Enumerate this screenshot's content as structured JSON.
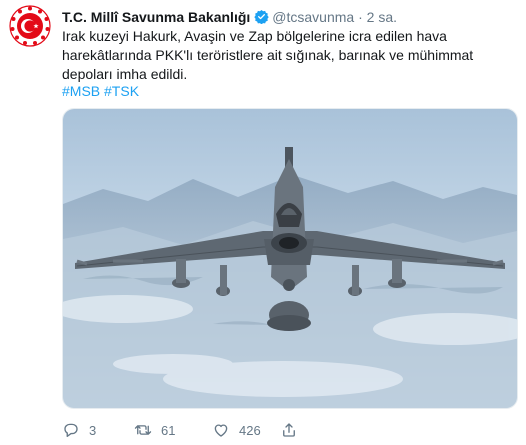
{
  "tweet": {
    "author_name": "T.C. Millî Savunma Bakanlığı",
    "handle": "@tcsavunma",
    "separator": "·",
    "time": "2 sa.",
    "text": "Irak kuzeyi Hakurk, Avaşin ve Zap bölgelerine icra edilen hava harekâtlarında PKK'lı teröristlere ait sığınak, barınak ve mühimmat depoları imha edildi.",
    "hashtags": [
      "#MSB",
      "#TSK"
    ]
  },
  "actions": {
    "replies": "3",
    "retweets": "61",
    "likes": "426"
  },
  "icons": {
    "avatar": "turkish-armed-forces-emblem",
    "verified": "verified-badge-icon",
    "reply": "reply-icon",
    "retweet": "retweet-icon",
    "like": "heart-icon",
    "share": "share-icon"
  },
  "colors": {
    "accent": "#1da1f2",
    "secondary_text": "#657786",
    "emblem_red": "#e30a17"
  }
}
